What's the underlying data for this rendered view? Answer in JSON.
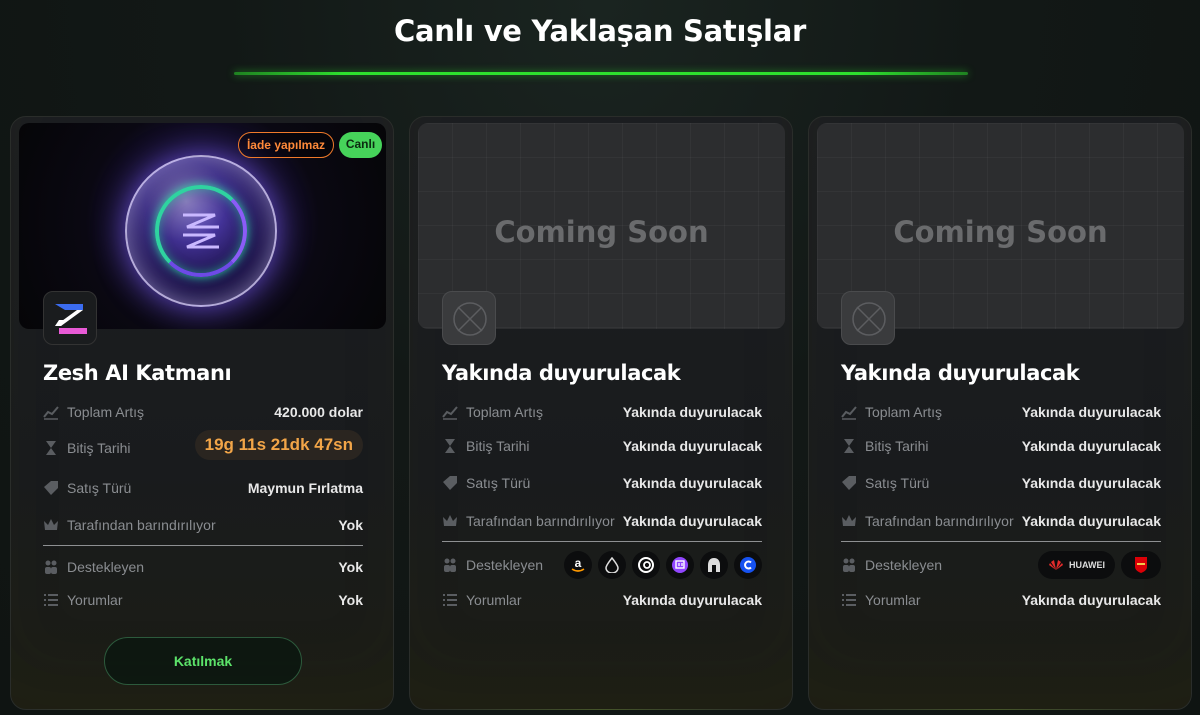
{
  "page": {
    "title": "Canlı ve Yaklaşan Satışlar"
  },
  "colors": {
    "accent": "#2ee12e",
    "countdown": "#f2a548",
    "live_badge": "#46d35a",
    "no_refund": "#ff8a3a"
  },
  "cards": [
    {
      "name": "Zesh AI Katmanı",
      "badges": {
        "no_refund": "İade yapılmaz",
        "live": "Canlı"
      },
      "rows": {
        "total_raise": {
          "label": "Toplam Artış",
          "value": "420.000 dolar"
        },
        "end_date": {
          "label": "Bitiş Tarihi",
          "value": "19g 11s 21dk 47sn"
        },
        "sale_type": {
          "label": "Satış Türü",
          "value": "Maymun Fırlatma"
        },
        "hosted_by": {
          "label": "Tarafından barındırılıyor",
          "value": "Yok"
        },
        "backers": {
          "label": "Destekleyen",
          "value": "Yok"
        },
        "reviews": {
          "label": "Yorumlar",
          "value": "Yok"
        }
      },
      "join_label": "Katılmak"
    },
    {
      "name": "Yakında duyurulacak",
      "banner_text": "Coming Soon",
      "rows": {
        "total_raise": {
          "label": "Toplam Artış",
          "value": "Yakında duyurulacak"
        },
        "end_date": {
          "label": "Bitiş Tarihi",
          "value": "Yakında duyurulacak"
        },
        "sale_type": {
          "label": "Satış Türü",
          "value": "Yakında duyurulacak"
        },
        "hosted_by": {
          "label": "Tarafından barındırılıyor",
          "value": "Yakında duyurulacak"
        },
        "backers": {
          "label": "Destekleyen",
          "icons": [
            "amazon-icon",
            "liquid-drop-icon",
            "ubisoft-icon",
            "twitch-icon",
            "spartan-helmet-icon",
            "coinbase-icon"
          ]
        },
        "reviews": {
          "label": "Yorumlar",
          "value": "Yakında duyurulacak"
        }
      }
    },
    {
      "name": "Yakında duyurulacak",
      "banner_text": "Coming Soon",
      "rows": {
        "total_raise": {
          "label": "Toplam Artış",
          "value": "Yakında duyurulacak"
        },
        "end_date": {
          "label": "Bitiş Tarihi",
          "value": "Yakında duyurulacak"
        },
        "sale_type": {
          "label": "Satış Türü",
          "value": "Yakında duyurulacak"
        },
        "hosted_by": {
          "label": "Tarafından barındırılıyor",
          "value": "Yakında duyurulacak"
        },
        "backers": {
          "label": "Destekleyen",
          "icons": [
            "huawei-logo",
            "arsenal-crest-icon"
          ],
          "huawei_text": "HUAWEI"
        },
        "reviews": {
          "label": "Yorumlar",
          "value": "Yakında duyurulacak"
        }
      }
    }
  ]
}
